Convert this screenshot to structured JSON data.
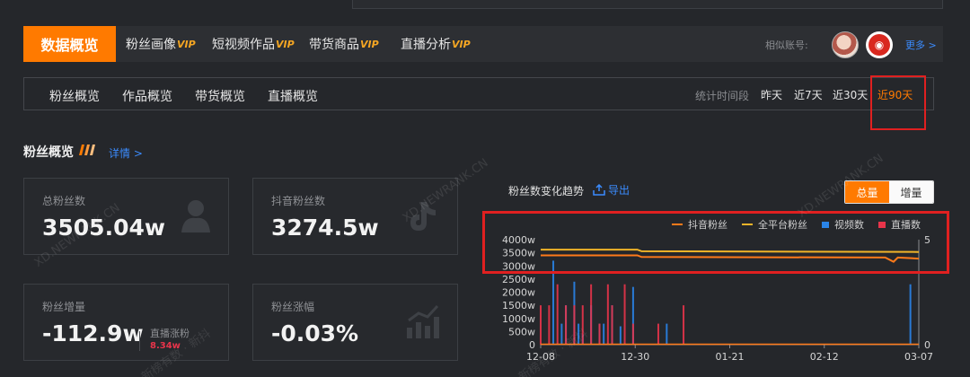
{
  "main_nav": {
    "active_tab": "数据概览",
    "tabs": [
      {
        "label": "粉丝画像",
        "vip": "VIP"
      },
      {
        "label": "短视频作品",
        "vip": "VIP"
      },
      {
        "label": "带货商品",
        "vip": "VIP"
      },
      {
        "label": "直播分析",
        "vip": "VIP"
      }
    ],
    "similar_accounts_label": "相似账号:",
    "more_link": "更多 >"
  },
  "sub_nav": {
    "tabs": [
      "粉丝概览",
      "作品概览",
      "带货概览",
      "直播概览"
    ],
    "time_label": "统计时间段",
    "time_options": [
      "昨天",
      "近7天",
      "近30天",
      "近90天"
    ],
    "active_time": "近90天"
  },
  "fan_overview": {
    "title": "粉丝概览",
    "detail_link": "详情 >",
    "cards": {
      "total_fans": {
        "label": "总粉丝数",
        "value": "3505.04w"
      },
      "douyin_fans": {
        "label": "抖音粉丝数",
        "value": "3274.5w"
      },
      "fan_growth": {
        "label": "粉丝增量",
        "value": "-112.9w",
        "live_label": "直播涨粉",
        "live_value": "8.34w"
      },
      "fan_rate": {
        "label": "粉丝涨幅",
        "value": "-0.03%"
      }
    }
  },
  "trend": {
    "title": "粉丝数变化趋势",
    "export_label": "导出",
    "toggle": {
      "total": "总量",
      "increment": "增量",
      "active": "总量"
    }
  },
  "watermark_text": "XD.NEWRANK.CN",
  "watermark_text_cn": "新榜有数 · 新抖",
  "colors": {
    "accent": "#ff7a00",
    "link": "#3b8cff",
    "douyin_fans": "#ff7a1a",
    "all_platform_fans": "#f0b429",
    "videos": "#2a84e8",
    "lives": "#e8344a"
  },
  "chart_data": {
    "type": "line",
    "legend": [
      "抖音粉丝",
      "全平台粉丝",
      "视频数",
      "直播数"
    ],
    "x_ticks": [
      "12-08",
      "12-30",
      "01-21",
      "02-12",
      "03-07"
    ],
    "y_left_ticks": [
      "0",
      "500w",
      "1000w",
      "1500w",
      "2000w",
      "2500w",
      "3000w",
      "3500w",
      "4000w"
    ],
    "y_right_ticks": [
      "0",
      "5"
    ],
    "y_left_range": [
      0,
      4000
    ],
    "y_right_range": [
      0,
      5
    ],
    "day_count": 90,
    "series": [
      {
        "name": "全平台粉丝",
        "type": "line",
        "points": [
          [
            0,
            3620
          ],
          [
            23,
            3620
          ],
          [
            24,
            3560
          ],
          [
            90,
            3530
          ]
        ]
      },
      {
        "name": "抖音粉丝",
        "type": "line",
        "points": [
          [
            0,
            3400
          ],
          [
            23,
            3400
          ],
          [
            24,
            3340
          ],
          [
            82,
            3320
          ],
          [
            84,
            3160
          ],
          [
            85,
            3320
          ],
          [
            90,
            3280
          ]
        ]
      },
      {
        "name": "视频数",
        "type": "bar",
        "points": [
          [
            3,
            3200
          ],
          [
            5,
            800
          ],
          [
            6,
            1500
          ],
          [
            8,
            2400
          ],
          [
            9,
            800
          ],
          [
            10,
            400
          ],
          [
            12,
            1500
          ],
          [
            14,
            800
          ],
          [
            15,
            800
          ],
          [
            17,
            1500
          ],
          [
            19,
            700
          ],
          [
            22,
            2200
          ],
          [
            30,
            800
          ],
          [
            88,
            2300
          ]
        ]
      },
      {
        "name": "直播数",
        "type": "bar",
        "points": [
          [
            0,
            1500
          ],
          [
            2,
            1500
          ],
          [
            4,
            2300
          ],
          [
            6,
            1500
          ],
          [
            8,
            1500
          ],
          [
            10,
            1500
          ],
          [
            12,
            2300
          ],
          [
            14,
            800
          ],
          [
            16,
            2300
          ],
          [
            17,
            1500
          ],
          [
            20,
            2300
          ],
          [
            22,
            800
          ],
          [
            28,
            800
          ],
          [
            34,
            1500
          ]
        ]
      }
    ]
  }
}
